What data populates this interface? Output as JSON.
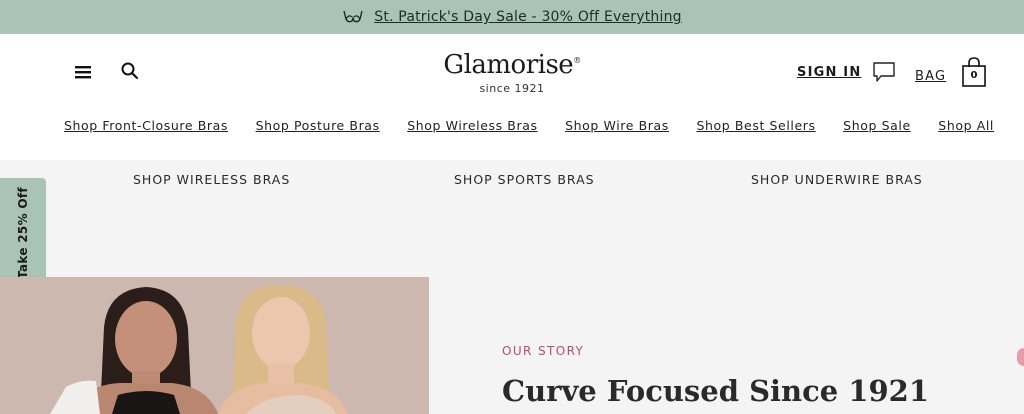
{
  "promo": {
    "icon": "bra-icon",
    "text": "St. Patrick's Day Sale - 30% Off Everything",
    "bg_color": "#a9c4b7"
  },
  "header": {
    "menu_icon": "hamburger-menu-icon",
    "search_icon": "search-icon",
    "logo": {
      "brand": "Glamorise",
      "mark": "®",
      "tagline": "since 1921"
    },
    "sign_in": "SIGN IN",
    "chat_icon": "chat-bubble-icon",
    "bag_label": "BAG",
    "bag_count": "0"
  },
  "nav": {
    "links": [
      "Shop Front-Closure Bras",
      "Shop Posture Bras",
      "Shop Wireless Bras",
      "Shop Wire Bras",
      "Shop Best Sellers",
      "Shop Sale",
      "Shop All"
    ]
  },
  "categories": [
    "SHOP WIRELESS BRAS",
    "SHOP SPORTS BRAS",
    "SHOP UNDERWIRE BRAS"
  ],
  "offer_tab": {
    "text": "Take 25% Off",
    "bg_color": "#a9c4b7"
  },
  "story": {
    "kicker": "OUR STORY",
    "title": "Curve Focused Since 1921",
    "kicker_color": "#b0506a"
  }
}
